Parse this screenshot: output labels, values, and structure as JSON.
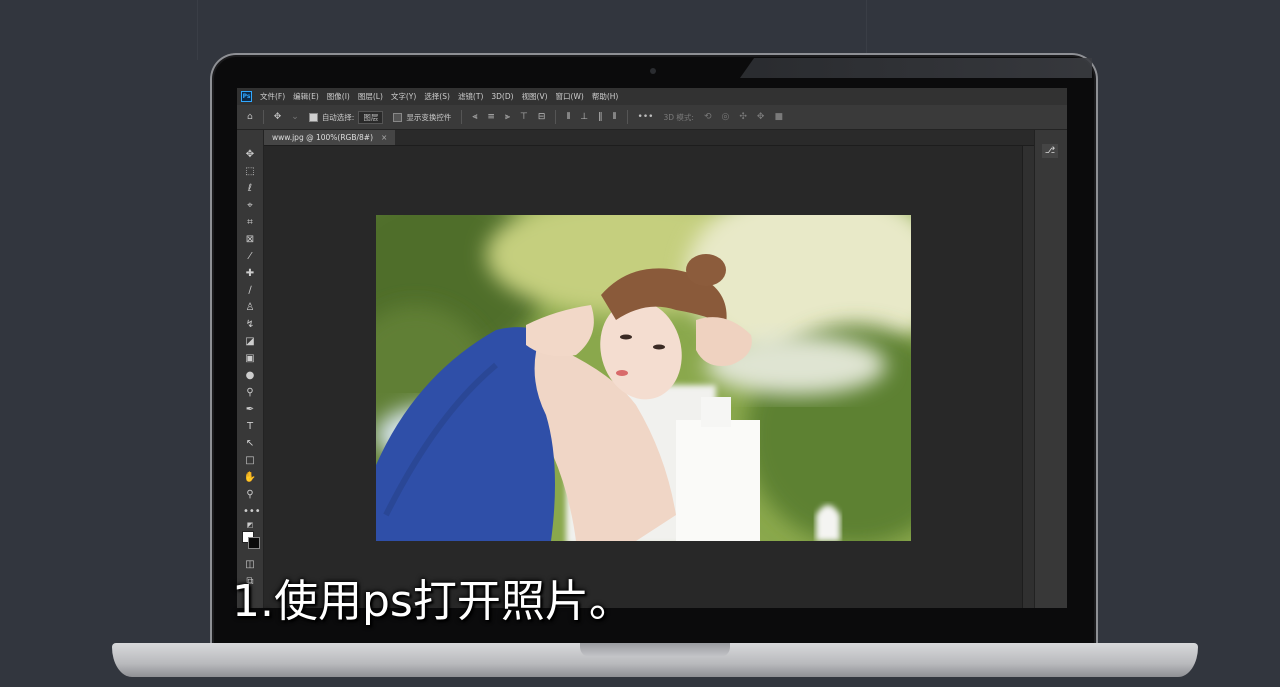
{
  "subtitle": "1.使用ps打开照片。",
  "photoshop": {
    "logo": "Ps",
    "menu": [
      "文件(F)",
      "编辑(E)",
      "图像(I)",
      "图层(L)",
      "文字(Y)",
      "选择(S)",
      "滤镜(T)",
      "3D(D)",
      "视图(V)",
      "窗口(W)",
      "帮助(H)"
    ],
    "options": {
      "auto_select_label": "自动选择:",
      "auto_select_value": "图层",
      "show_transform_label": "显示变换控件",
      "mode_3d_label": "3D 模式:"
    },
    "document_tab": "www.jpg @ 100%(RGB/8#)",
    "tab_close": "×"
  },
  "icons": {
    "home": "home-icon",
    "move": "move-tool-icon",
    "more": "more-icon",
    "panel": "history-panel-icon"
  },
  "colors": {
    "page_bg": "#32363e",
    "ps_ui": "#383838",
    "ps_canvas": "#282828",
    "dress_blue": "#2f4fa8"
  }
}
